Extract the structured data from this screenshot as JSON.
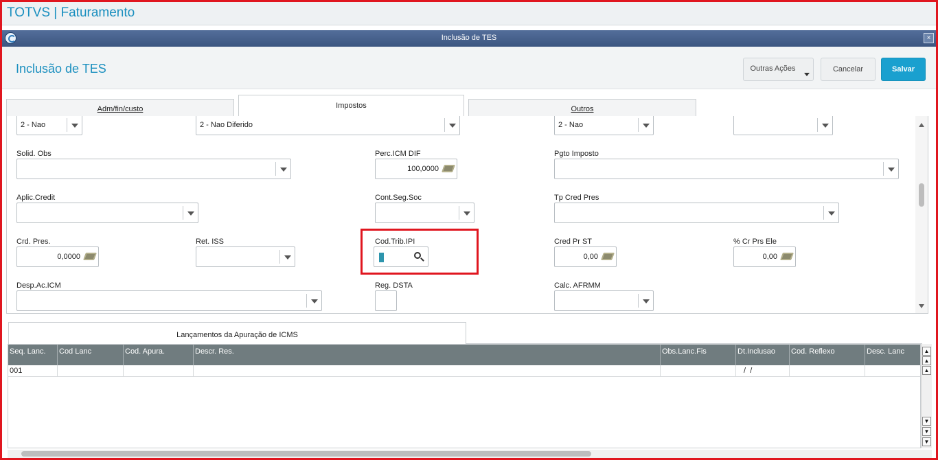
{
  "app": {
    "title": "TOTVS | Faturamento"
  },
  "dialog": {
    "title": "Inclusão de TES",
    "close_glyph": "×"
  },
  "toolbar": {
    "page_title": "Inclusão de TES",
    "outras_label": "Outras Ações",
    "cancel_label": "Cancelar",
    "save_label": "Salvar"
  },
  "tabs": {
    "items": [
      {
        "label": "Adm/fin/custo"
      },
      {
        "label": "Impostos"
      },
      {
        "label": "Outros"
      }
    ],
    "active": "Impostos"
  },
  "form": {
    "row0": {
      "sel1": "2 - Nao",
      "sel2": "2 - Nao Diferido",
      "sel3": "2 - Nao",
      "sel4": ""
    },
    "solid_obs": {
      "label": "Solid. Obs",
      "value": ""
    },
    "perc_icm_dif": {
      "label": "Perc.ICM DIF",
      "value": "100,0000"
    },
    "pgto_imposto": {
      "label": "Pgto Imposto",
      "value": ""
    },
    "aplic_credit": {
      "label": "Aplic.Credit",
      "value": ""
    },
    "cont_seg_soc": {
      "label": "Cont.Seg.Soc",
      "value": ""
    },
    "tp_cred_pres": {
      "label": "Tp Cred Pres",
      "value": ""
    },
    "crd_pres": {
      "label": "Crd. Pres.",
      "value": "0,0000"
    },
    "ret_iss": {
      "label": "Ret. ISS",
      "value": ""
    },
    "cod_trib_ipi": {
      "label": "Cod.Trib.IPI",
      "value": ""
    },
    "cred_pr_st": {
      "label": "Cred  Pr ST",
      "value": "0,00"
    },
    "cr_prs_ele": {
      "label": "% Cr Prs Ele",
      "value": "0,00"
    },
    "desp_ac_icm": {
      "label": "Desp.Ac.ICM",
      "value": ""
    },
    "reg_dsta": {
      "label": "Reg. DSTA",
      "value": ""
    },
    "calc_afrmm": {
      "label": "Calc. AFRMM",
      "value": ""
    }
  },
  "grid": {
    "tab_label": "Lançamentos da Apuração de ICMS",
    "columns": [
      "Seq. Lanc.",
      "Cod Lanc",
      "Cod. Apura.",
      "Descr. Res.",
      "Obs.Lanc.Fis",
      "Dt.Inclusao",
      "Cod. Reflexo",
      "Desc. Lanc"
    ],
    "rows": [
      [
        "001",
        "",
        "",
        "",
        "",
        " /  /",
        "",
        ""
      ]
    ]
  },
  "colors": {
    "accent": "#1a8fbf",
    "save": "#1aa0cf",
    "highlight": "#e0161f",
    "grid_header": "#707c7f"
  }
}
